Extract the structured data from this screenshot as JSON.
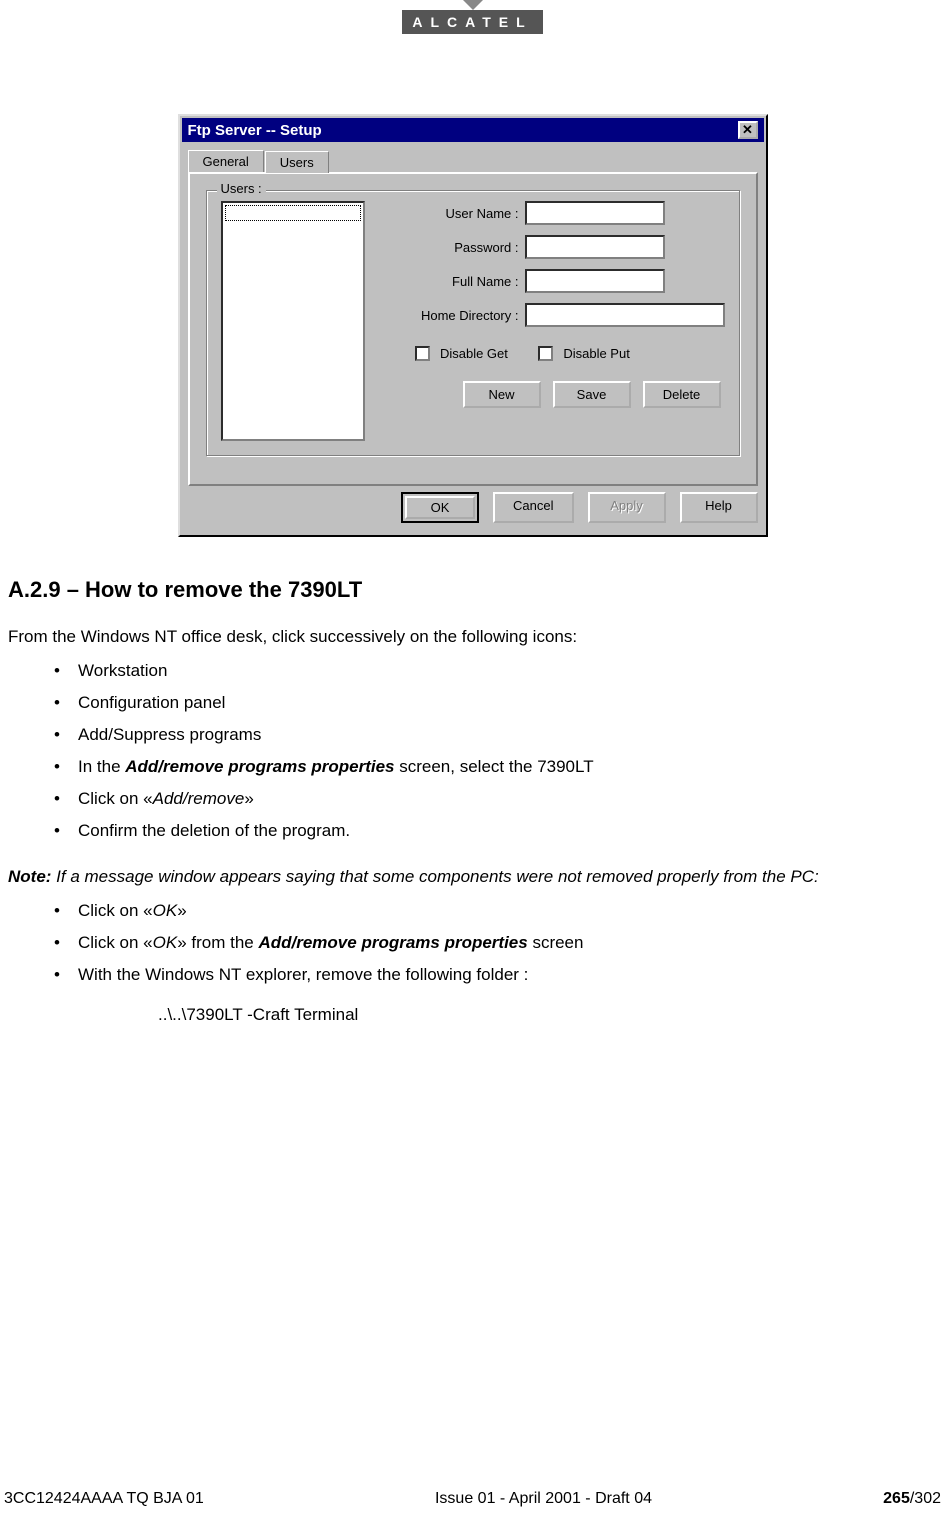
{
  "logo": {
    "text": "ALCATEL"
  },
  "dialog": {
    "title": "Ftp Server -- Setup",
    "tabs": {
      "general": "General",
      "users": "Users"
    },
    "legend": "Users :",
    "labels": {
      "username": "User Name :",
      "password": "Password :",
      "fullname": "Full Name :",
      "homedir": "Home Directory :",
      "disable_get": "Disable Get",
      "disable_put": "Disable Put"
    },
    "buttons": {
      "new": "New",
      "save": "Save",
      "delete": "Delete",
      "ok": "OK",
      "cancel": "Cancel",
      "apply": "Apply",
      "help": "Help"
    }
  },
  "section": {
    "heading": "A.2.9 – How to remove the 7390LT",
    "intro": "From the Windows NT office desk, click successively on the following icons:",
    "bullets": {
      "b1": "Workstation",
      "b2": "Configuration panel",
      "b3": "Add/Suppress programs",
      "b4_pre": "In the ",
      "b4_bold": "Add/remove programs properties",
      "b4_post": " screen, select the 7390LT",
      "b5_pre": "Click on «",
      "b5_it": "Add/remove",
      "b5_post": "»",
      "b6": "Confirm the deletion of the program."
    },
    "note": {
      "lead": "Note: ",
      "text": "If a message window appears saying that some components were not removed properly from the PC:",
      "n1_pre": "Click on «",
      "n1_it": "OK",
      "n1_post": "»",
      "n2_pre": "Click on «",
      "n2_it": "OK",
      "n2_mid": "» from the ",
      "n2_bold": "Add/remove programs properties",
      "n2_post": " screen",
      "n3": "With the Windows NT explorer, remove the following folder :",
      "folder": "..\\..\\7390LT -Craft Terminal"
    }
  },
  "footer": {
    "left": "3CC12424AAAA TQ BJA 01",
    "center": "Issue 01 - April 2001 - Draft 04",
    "page_bold": "265",
    "page_total": "/302"
  }
}
